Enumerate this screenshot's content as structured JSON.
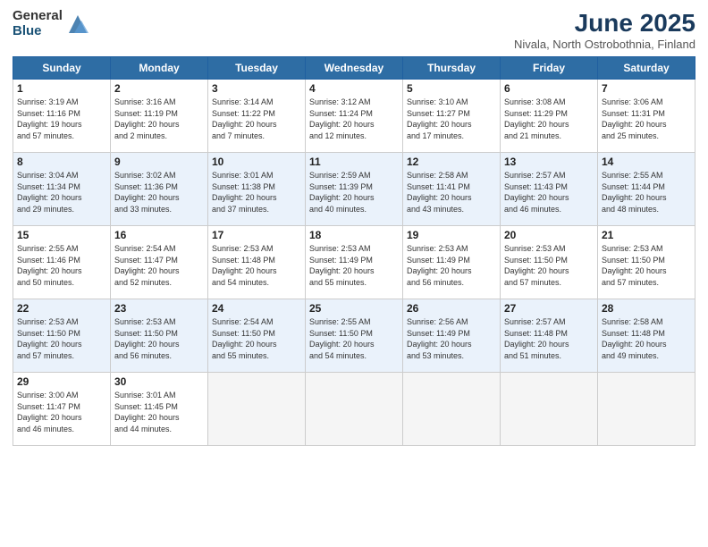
{
  "logo": {
    "general": "General",
    "blue": "Blue"
  },
  "title": "June 2025",
  "location": "Nivala, North Ostrobothnia, Finland",
  "weekdays": [
    "Sunday",
    "Monday",
    "Tuesday",
    "Wednesday",
    "Thursday",
    "Friday",
    "Saturday"
  ],
  "weeks": [
    [
      {
        "day": "1",
        "info": "Sunrise: 3:19 AM\nSunset: 11:16 PM\nDaylight: 19 hours\nand 57 minutes."
      },
      {
        "day": "2",
        "info": "Sunrise: 3:16 AM\nSunset: 11:19 PM\nDaylight: 20 hours\nand 2 minutes."
      },
      {
        "day": "3",
        "info": "Sunrise: 3:14 AM\nSunset: 11:22 PM\nDaylight: 20 hours\nand 7 minutes."
      },
      {
        "day": "4",
        "info": "Sunrise: 3:12 AM\nSunset: 11:24 PM\nDaylight: 20 hours\nand 12 minutes."
      },
      {
        "day": "5",
        "info": "Sunrise: 3:10 AM\nSunset: 11:27 PM\nDaylight: 20 hours\nand 17 minutes."
      },
      {
        "day": "6",
        "info": "Sunrise: 3:08 AM\nSunset: 11:29 PM\nDaylight: 20 hours\nand 21 minutes."
      },
      {
        "day": "7",
        "info": "Sunrise: 3:06 AM\nSunset: 11:31 PM\nDaylight: 20 hours\nand 25 minutes."
      }
    ],
    [
      {
        "day": "8",
        "info": "Sunrise: 3:04 AM\nSunset: 11:34 PM\nDaylight: 20 hours\nand 29 minutes."
      },
      {
        "day": "9",
        "info": "Sunrise: 3:02 AM\nSunset: 11:36 PM\nDaylight: 20 hours\nand 33 minutes."
      },
      {
        "day": "10",
        "info": "Sunrise: 3:01 AM\nSunset: 11:38 PM\nDaylight: 20 hours\nand 37 minutes."
      },
      {
        "day": "11",
        "info": "Sunrise: 2:59 AM\nSunset: 11:39 PM\nDaylight: 20 hours\nand 40 minutes."
      },
      {
        "day": "12",
        "info": "Sunrise: 2:58 AM\nSunset: 11:41 PM\nDaylight: 20 hours\nand 43 minutes."
      },
      {
        "day": "13",
        "info": "Sunrise: 2:57 AM\nSunset: 11:43 PM\nDaylight: 20 hours\nand 46 minutes."
      },
      {
        "day": "14",
        "info": "Sunrise: 2:55 AM\nSunset: 11:44 PM\nDaylight: 20 hours\nand 48 minutes."
      }
    ],
    [
      {
        "day": "15",
        "info": "Sunrise: 2:55 AM\nSunset: 11:46 PM\nDaylight: 20 hours\nand 50 minutes."
      },
      {
        "day": "16",
        "info": "Sunrise: 2:54 AM\nSunset: 11:47 PM\nDaylight: 20 hours\nand 52 minutes."
      },
      {
        "day": "17",
        "info": "Sunrise: 2:53 AM\nSunset: 11:48 PM\nDaylight: 20 hours\nand 54 minutes."
      },
      {
        "day": "18",
        "info": "Sunrise: 2:53 AM\nSunset: 11:49 PM\nDaylight: 20 hours\nand 55 minutes."
      },
      {
        "day": "19",
        "info": "Sunrise: 2:53 AM\nSunset: 11:49 PM\nDaylight: 20 hours\nand 56 minutes."
      },
      {
        "day": "20",
        "info": "Sunrise: 2:53 AM\nSunset: 11:50 PM\nDaylight: 20 hours\nand 57 minutes."
      },
      {
        "day": "21",
        "info": "Sunrise: 2:53 AM\nSunset: 11:50 PM\nDaylight: 20 hours\nand 57 minutes."
      }
    ],
    [
      {
        "day": "22",
        "info": "Sunrise: 2:53 AM\nSunset: 11:50 PM\nDaylight: 20 hours\nand 57 minutes."
      },
      {
        "day": "23",
        "info": "Sunrise: 2:53 AM\nSunset: 11:50 PM\nDaylight: 20 hours\nand 56 minutes."
      },
      {
        "day": "24",
        "info": "Sunrise: 2:54 AM\nSunset: 11:50 PM\nDaylight: 20 hours\nand 55 minutes."
      },
      {
        "day": "25",
        "info": "Sunrise: 2:55 AM\nSunset: 11:50 PM\nDaylight: 20 hours\nand 54 minutes."
      },
      {
        "day": "26",
        "info": "Sunrise: 2:56 AM\nSunset: 11:49 PM\nDaylight: 20 hours\nand 53 minutes."
      },
      {
        "day": "27",
        "info": "Sunrise: 2:57 AM\nSunset: 11:48 PM\nDaylight: 20 hours\nand 51 minutes."
      },
      {
        "day": "28",
        "info": "Sunrise: 2:58 AM\nSunset: 11:48 PM\nDaylight: 20 hours\nand 49 minutes."
      }
    ],
    [
      {
        "day": "29",
        "info": "Sunrise: 3:00 AM\nSunset: 11:47 PM\nDaylight: 20 hours\nand 46 minutes."
      },
      {
        "day": "30",
        "info": "Sunrise: 3:01 AM\nSunset: 11:45 PM\nDaylight: 20 hours\nand 44 minutes."
      },
      null,
      null,
      null,
      null,
      null
    ]
  ]
}
